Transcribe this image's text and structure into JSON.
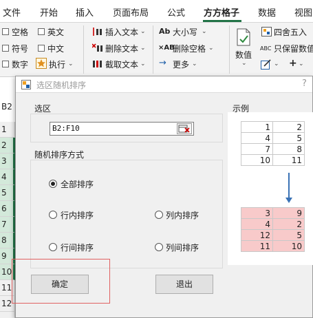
{
  "ribbon": {
    "tabs": [
      "文件",
      "开始",
      "插入",
      "页面布局",
      "公式",
      "方方格子",
      "数据",
      "视图"
    ],
    "active_tab": "方方格子",
    "checkboxes": [
      "空格",
      "英文",
      "符号",
      "中文",
      "数字"
    ],
    "execute_label": "执行",
    "text_tools": [
      "插入文本",
      "删除文本",
      "截取文本"
    ],
    "case_label": "大小写",
    "case_icon_text": "Ab",
    "delete_space_label": "删除空格",
    "delete_space_icon_text": "×AB",
    "more_label": "更多",
    "numeric_label": "数值",
    "round_label": "四舍五入",
    "keep_label": "只保留数值",
    "keep_icon_text": "ABC",
    "accent_color": "#217346"
  },
  "sheet": {
    "name_box": "B2",
    "row_numbers": [
      "1",
      "2",
      "3",
      "4",
      "5",
      "6",
      "7",
      "8",
      "9",
      "10",
      "11",
      "12"
    ]
  },
  "dialog": {
    "title": "选区随机排序",
    "help": "?",
    "range_label": "选区",
    "range_value": "B2:F10",
    "mode_label": "随机排序方式",
    "options": [
      "全部排序",
      "行内排序",
      "列内排序",
      "行间排序",
      "列间排序"
    ],
    "selected_option": "全部排序",
    "ok_label": "确定",
    "exit_label": "退出",
    "example_label": "示例",
    "example_before": [
      [
        "1",
        "2"
      ],
      [
        "4",
        "5"
      ],
      [
        "7",
        "8"
      ],
      [
        "10",
        "11"
      ]
    ],
    "example_after": [
      [
        "3",
        "9"
      ],
      [
        "4",
        "2"
      ],
      [
        "12",
        "5"
      ],
      [
        "11",
        "10"
      ]
    ],
    "highlight_color": "#f8caca",
    "arrow_color": "#3a72b5"
  }
}
